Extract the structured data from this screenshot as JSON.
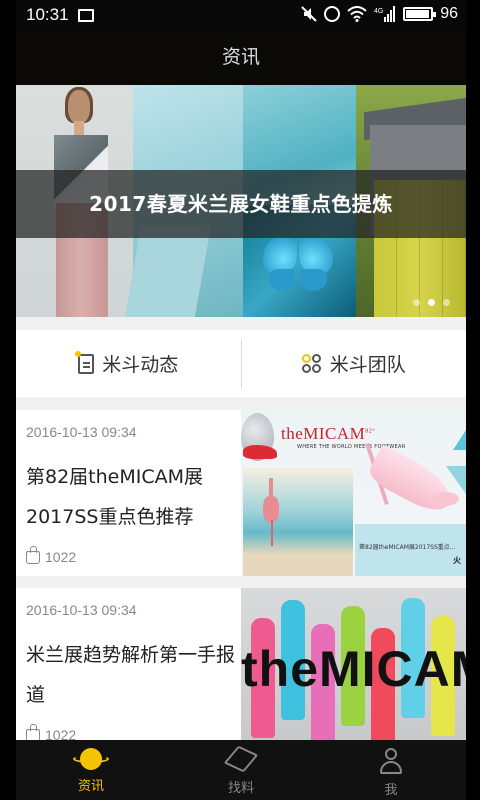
{
  "status_bar": {
    "time": "10:31",
    "battery": "96",
    "battery_level": 0.96,
    "network_label": "4G",
    "icons": [
      "image-icon",
      "mute-icon",
      "alarm-icon",
      "wifi-icon",
      "signal-icon",
      "battery-icon"
    ]
  },
  "header": {
    "title": "资讯"
  },
  "banner": {
    "caption": "2017春夏米兰展女鞋重点色提炼",
    "pages": 3,
    "active_page": 2
  },
  "categories": [
    {
      "label": "米斗动态",
      "icon": "document-icon"
    },
    {
      "label": "米斗团队",
      "icon": "team-icon"
    }
  ],
  "news": [
    {
      "date": "2016-10-13 09:34",
      "title": "第82届theMICAM展2017SS重点色推荐",
      "likes": "1022",
      "image": {
        "logo_text": "theMICAM",
        "logo_sup": "82°",
        "logo_sub": "WHERE THE WORLD MEETS FOOTWEAR",
        "caption": "第82届theMICAM展2017SS重点...",
        "caption_tail": "火"
      }
    },
    {
      "date": "2016-10-13 09:34",
      "title": "米兰展趋势解析第一手报道",
      "likes": "1022",
      "image": {
        "overlay_text": "theMICAM"
      }
    }
  ],
  "tabbar": {
    "items": [
      {
        "label": "资讯",
        "icon": "planet-icon",
        "active": true
      },
      {
        "label": "找料",
        "icon": "paper-plane-icon",
        "active": false
      },
      {
        "label": "我",
        "icon": "user-icon",
        "active": false
      }
    ]
  },
  "colors": {
    "accent": "#f5c400",
    "header_bg": "#0a0906",
    "tabbar_bg": "#111111",
    "text_muted": "#888888"
  }
}
